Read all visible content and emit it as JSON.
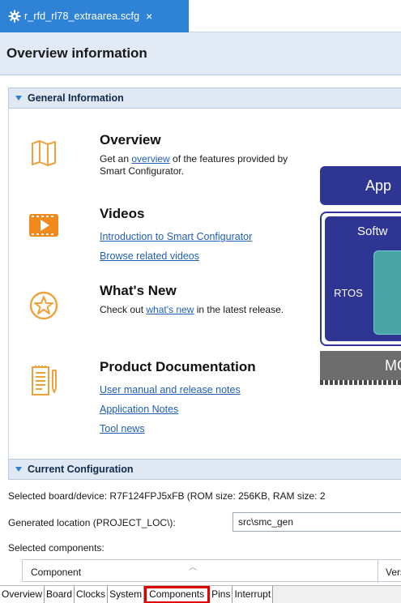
{
  "editor_tab": {
    "filename": "r_rfd_rl78_extraarea.scfg",
    "close_glyph": "×"
  },
  "overview": {
    "title": "Overview information"
  },
  "general_section": {
    "label": "General Information",
    "items": [
      {
        "heading": "Overview",
        "desc_pre": "Get an ",
        "desc_link": "overview",
        "desc_post": " of the features provided by Smart Configurator.",
        "icon": "map-icon"
      },
      {
        "heading": "Videos",
        "links": [
          "Introduction to Smart Configurator",
          "Browse related videos"
        ],
        "icon": "video-icon"
      },
      {
        "heading": "What's New",
        "desc_pre": "Check out ",
        "desc_link": "what's new",
        "desc_post": " in the latest release.",
        "icon": "star-icon"
      },
      {
        "heading": "Product Documentation",
        "links": [
          "User manual and release notes",
          "Application Notes",
          "Tool news"
        ],
        "icon": "document-icon"
      }
    ],
    "diagram": {
      "app": "App",
      "software": "Softw",
      "rtos": "RTOS",
      "mcu": "MC"
    }
  },
  "current_config": {
    "label": "Current Configuration",
    "board_device": "Selected board/device:  R7F124FPJ5xFB (ROM size: 256KB, RAM size: 2",
    "location_label": "Generated location (PROJECT_LOC\\):",
    "location_value": "src\\smc_gen",
    "components_label": "Selected components:",
    "table_columns": [
      "Component",
      "Version"
    ]
  },
  "bottom_tabs": [
    "Overview",
    "Board",
    "Clocks",
    "System",
    "Components",
    "Pins",
    "Interrupt"
  ],
  "colors": {
    "accent": "#2f83d6",
    "diagram_blue": "#2e3592",
    "highlight": "#e00000"
  }
}
